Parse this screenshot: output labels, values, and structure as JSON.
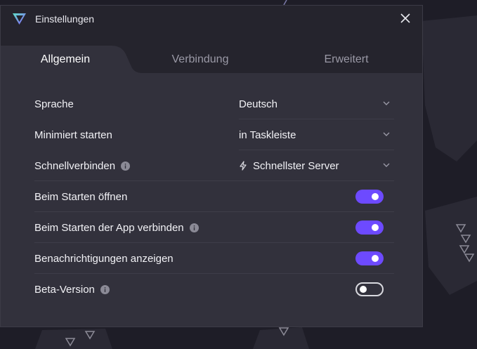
{
  "window": {
    "title": "Einstellungen",
    "icons": {
      "logo": "protonvpn-logo-icon",
      "close": "close-icon"
    }
  },
  "tabs": [
    {
      "label": "Allgemein",
      "active": true
    },
    {
      "label": "Verbindung",
      "active": false
    },
    {
      "label": "Erweitert",
      "active": false
    }
  ],
  "settings": {
    "language": {
      "label": "Sprache",
      "value": "Deutsch"
    },
    "start_minimized": {
      "label": "Minimiert starten",
      "value": "in Taskleiste"
    },
    "quick_connect": {
      "label": "Schnellverbinden",
      "value": "Schnellster Server",
      "icon": "bolt-icon"
    },
    "open_on_start": {
      "label": "Beim Starten öffnen",
      "enabled": true
    },
    "connect_on_app_start": {
      "label": "Beim Starten der App verbinden",
      "enabled": true
    },
    "show_notifications": {
      "label": "Benachrichtigungen anzeigen",
      "enabled": true
    },
    "beta": {
      "label": "Beta-Version",
      "enabled": false
    }
  },
  "colors": {
    "accent": "#6d4aff",
    "window_bg": "#32313c",
    "titlebar_bg": "#25242d"
  }
}
